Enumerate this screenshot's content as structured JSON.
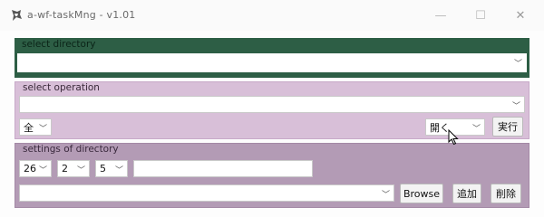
{
  "window": {
    "title": "a-wf-taskMng - v1.01",
    "min_label": "—",
    "max_label": "☐",
    "close_label": "✕"
  },
  "select_directory": {
    "legend": "select directory",
    "directory_value": ""
  },
  "select_operation": {
    "legend": "select operation",
    "operation_value": "",
    "scope_value": "全",
    "action_value": "開く",
    "execute_label": "実行"
  },
  "settings_of_directory": {
    "legend": "settings of directory",
    "year_value": "26",
    "month_value": "2",
    "day_value": "5",
    "name_value": "",
    "path_value": "",
    "browse_label": "Browse",
    "add_label": "追加",
    "delete_label": "削除"
  },
  "colors": {
    "group1": "#2d5e45",
    "group2": "#d8bfd8",
    "group3": "#b39bb5"
  },
  "icons": {
    "app": "app-logo-icon",
    "dropdown": "chevron-down-icon",
    "cursor": "mouse-pointer-icon"
  }
}
